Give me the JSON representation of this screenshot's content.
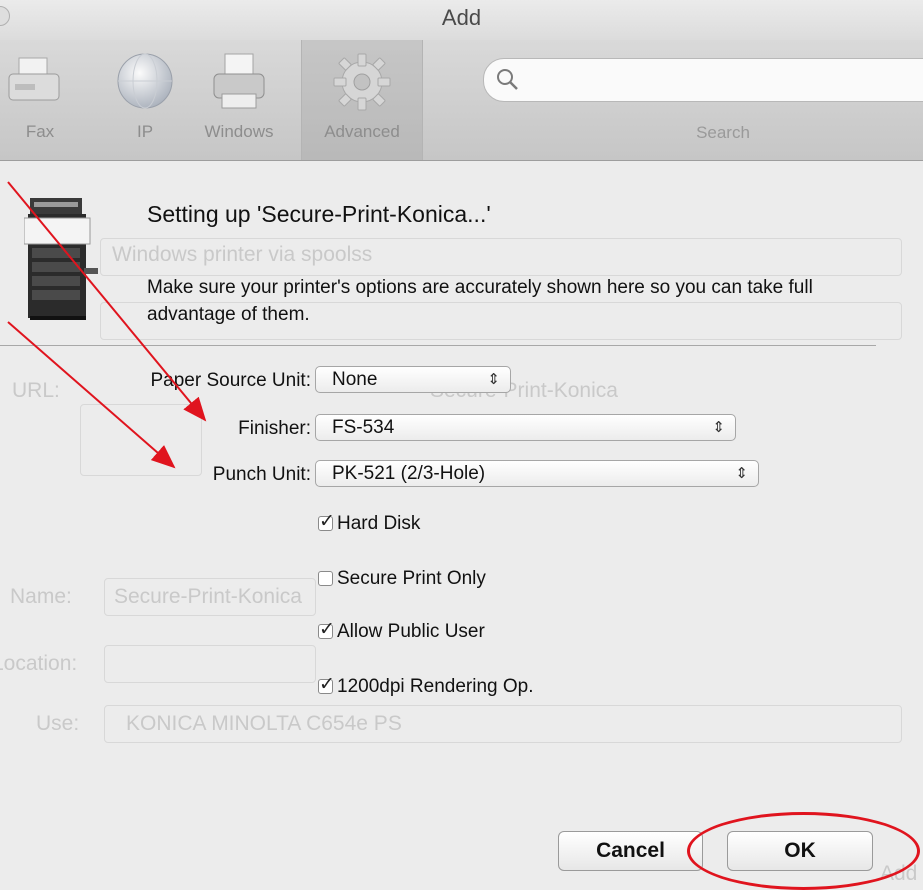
{
  "window": {
    "title": "Add"
  },
  "toolbar": {
    "items": [
      {
        "label": "Fax",
        "icon": "fax-icon"
      },
      {
        "label": "IP",
        "icon": "globe-icon"
      },
      {
        "label": "Windows",
        "icon": "printer-icon"
      },
      {
        "label": "Advanced",
        "icon": "gear-icon",
        "selected": true
      }
    ],
    "search": {
      "label": "Search",
      "placeholder": "",
      "icon": "search-icon"
    }
  },
  "background_form": {
    "type_value": "Windows printer via spoolss",
    "url_value": "Secure-Print-Konica",
    "name_label": "Name:",
    "name_value": "Secure-Print-Konica",
    "location_label": "Location:",
    "use_label": "Use:",
    "use_value": "KONICA MINOLTA C654e PS",
    "add_label": "Add",
    "url_label": "URL:"
  },
  "sheet": {
    "heading": "Setting up 'Secure-Print-Konica...'",
    "description": "Make sure your printer's options are accurately shown here so you can take full advantage of them.",
    "options": {
      "paper_source": {
        "label": "Paper Source Unit:",
        "value": "None"
      },
      "finisher": {
        "label": "Finisher:",
        "value": "FS-534"
      },
      "punch": {
        "label": "Punch Unit:",
        "value": "PK-521 (2/3-Hole)"
      }
    },
    "checkboxes": [
      {
        "label": "Hard Disk",
        "checked": true
      },
      {
        "label": "Secure Print Only",
        "checked": false
      },
      {
        "label": "Allow Public User",
        "checked": true
      },
      {
        "label": "1200dpi Rendering Op.",
        "checked": true
      }
    ],
    "buttons": {
      "cancel": "Cancel",
      "ok": "OK"
    }
  },
  "colors": {
    "annotation": "#e0141e",
    "window_bg": "#ececec",
    "toolbar_bg": "#d0d0d0"
  }
}
